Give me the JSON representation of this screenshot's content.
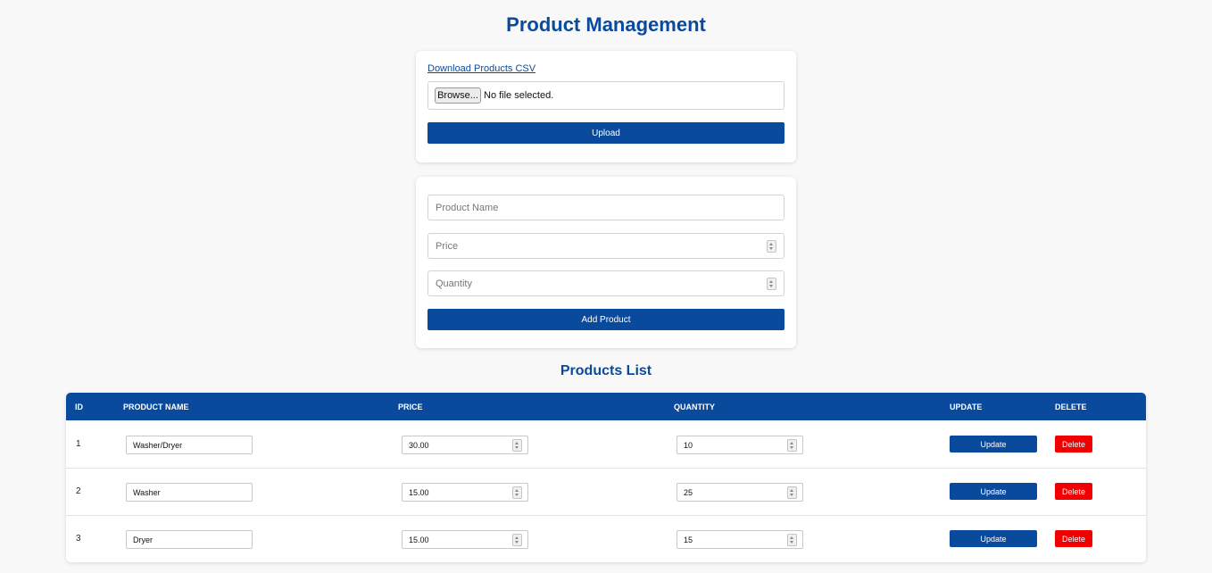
{
  "header": {
    "title": "Product Management"
  },
  "upload": {
    "csv_link": "Download Products CSV",
    "browse_label": "Browse...",
    "file_status": "No file selected.",
    "upload_label": "Upload"
  },
  "form": {
    "name_placeholder": "Product Name",
    "price_placeholder": "Price",
    "quantity_placeholder": "Quantity",
    "add_label": "Add Product"
  },
  "list": {
    "title": "Products List",
    "columns": [
      "ID",
      "PRODUCT NAME",
      "PRICE",
      "QUANTITY",
      "UPDATE",
      "DELETE"
    ],
    "update_label": "Update",
    "delete_label": "Delete",
    "rows": [
      {
        "id": "1",
        "name": "Washer/Dryer",
        "price": "30.00",
        "quantity": "10"
      },
      {
        "id": "2",
        "name": "Washer",
        "price": "15.00",
        "quantity": "25"
      },
      {
        "id": "3",
        "name": "Dryer",
        "price": "15.00",
        "quantity": "15"
      }
    ]
  },
  "colors": {
    "primary": "#0a4a9c",
    "danger": "#f00000",
    "background": "#f8f8f8"
  }
}
